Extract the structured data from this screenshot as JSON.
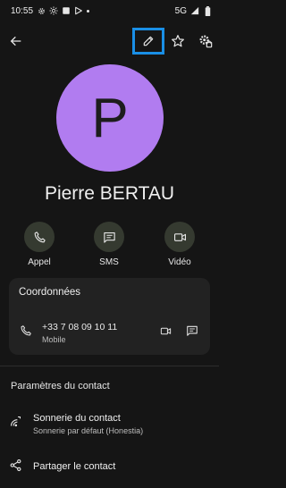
{
  "status_bar": {
    "time": "10:55",
    "network": "5G"
  },
  "toolbar": {
    "back_icon": "arrow-back-icon",
    "edit_icon": "pencil-icon",
    "favorite_icon": "star-outline-icon",
    "settings_icon": "contact-settings-icon"
  },
  "contact": {
    "initial": "P",
    "name": "Pierre BERTAU",
    "avatar_color": "#b17cf0"
  },
  "actions": [
    {
      "label": "Appel",
      "icon": "phone-icon"
    },
    {
      "label": "SMS",
      "icon": "message-icon"
    },
    {
      "label": "Vidéo",
      "icon": "videocam-icon"
    }
  ],
  "coordinates_card": {
    "title": "Coordonnées",
    "phone_number": "+33 7 08 09 10 11",
    "phone_type": "Mobile"
  },
  "settings_section": {
    "title": "Paramètres du contact",
    "ringtone_title": "Sonnerie du contact",
    "ringtone_sub": "Sonnerie par défaut (Honestia)",
    "share_title": "Partager le contact"
  },
  "colors": {
    "background": "#151515",
    "action_circle": "#353a30",
    "card": "#222222",
    "highlight_box": "#1a8fe6"
  }
}
